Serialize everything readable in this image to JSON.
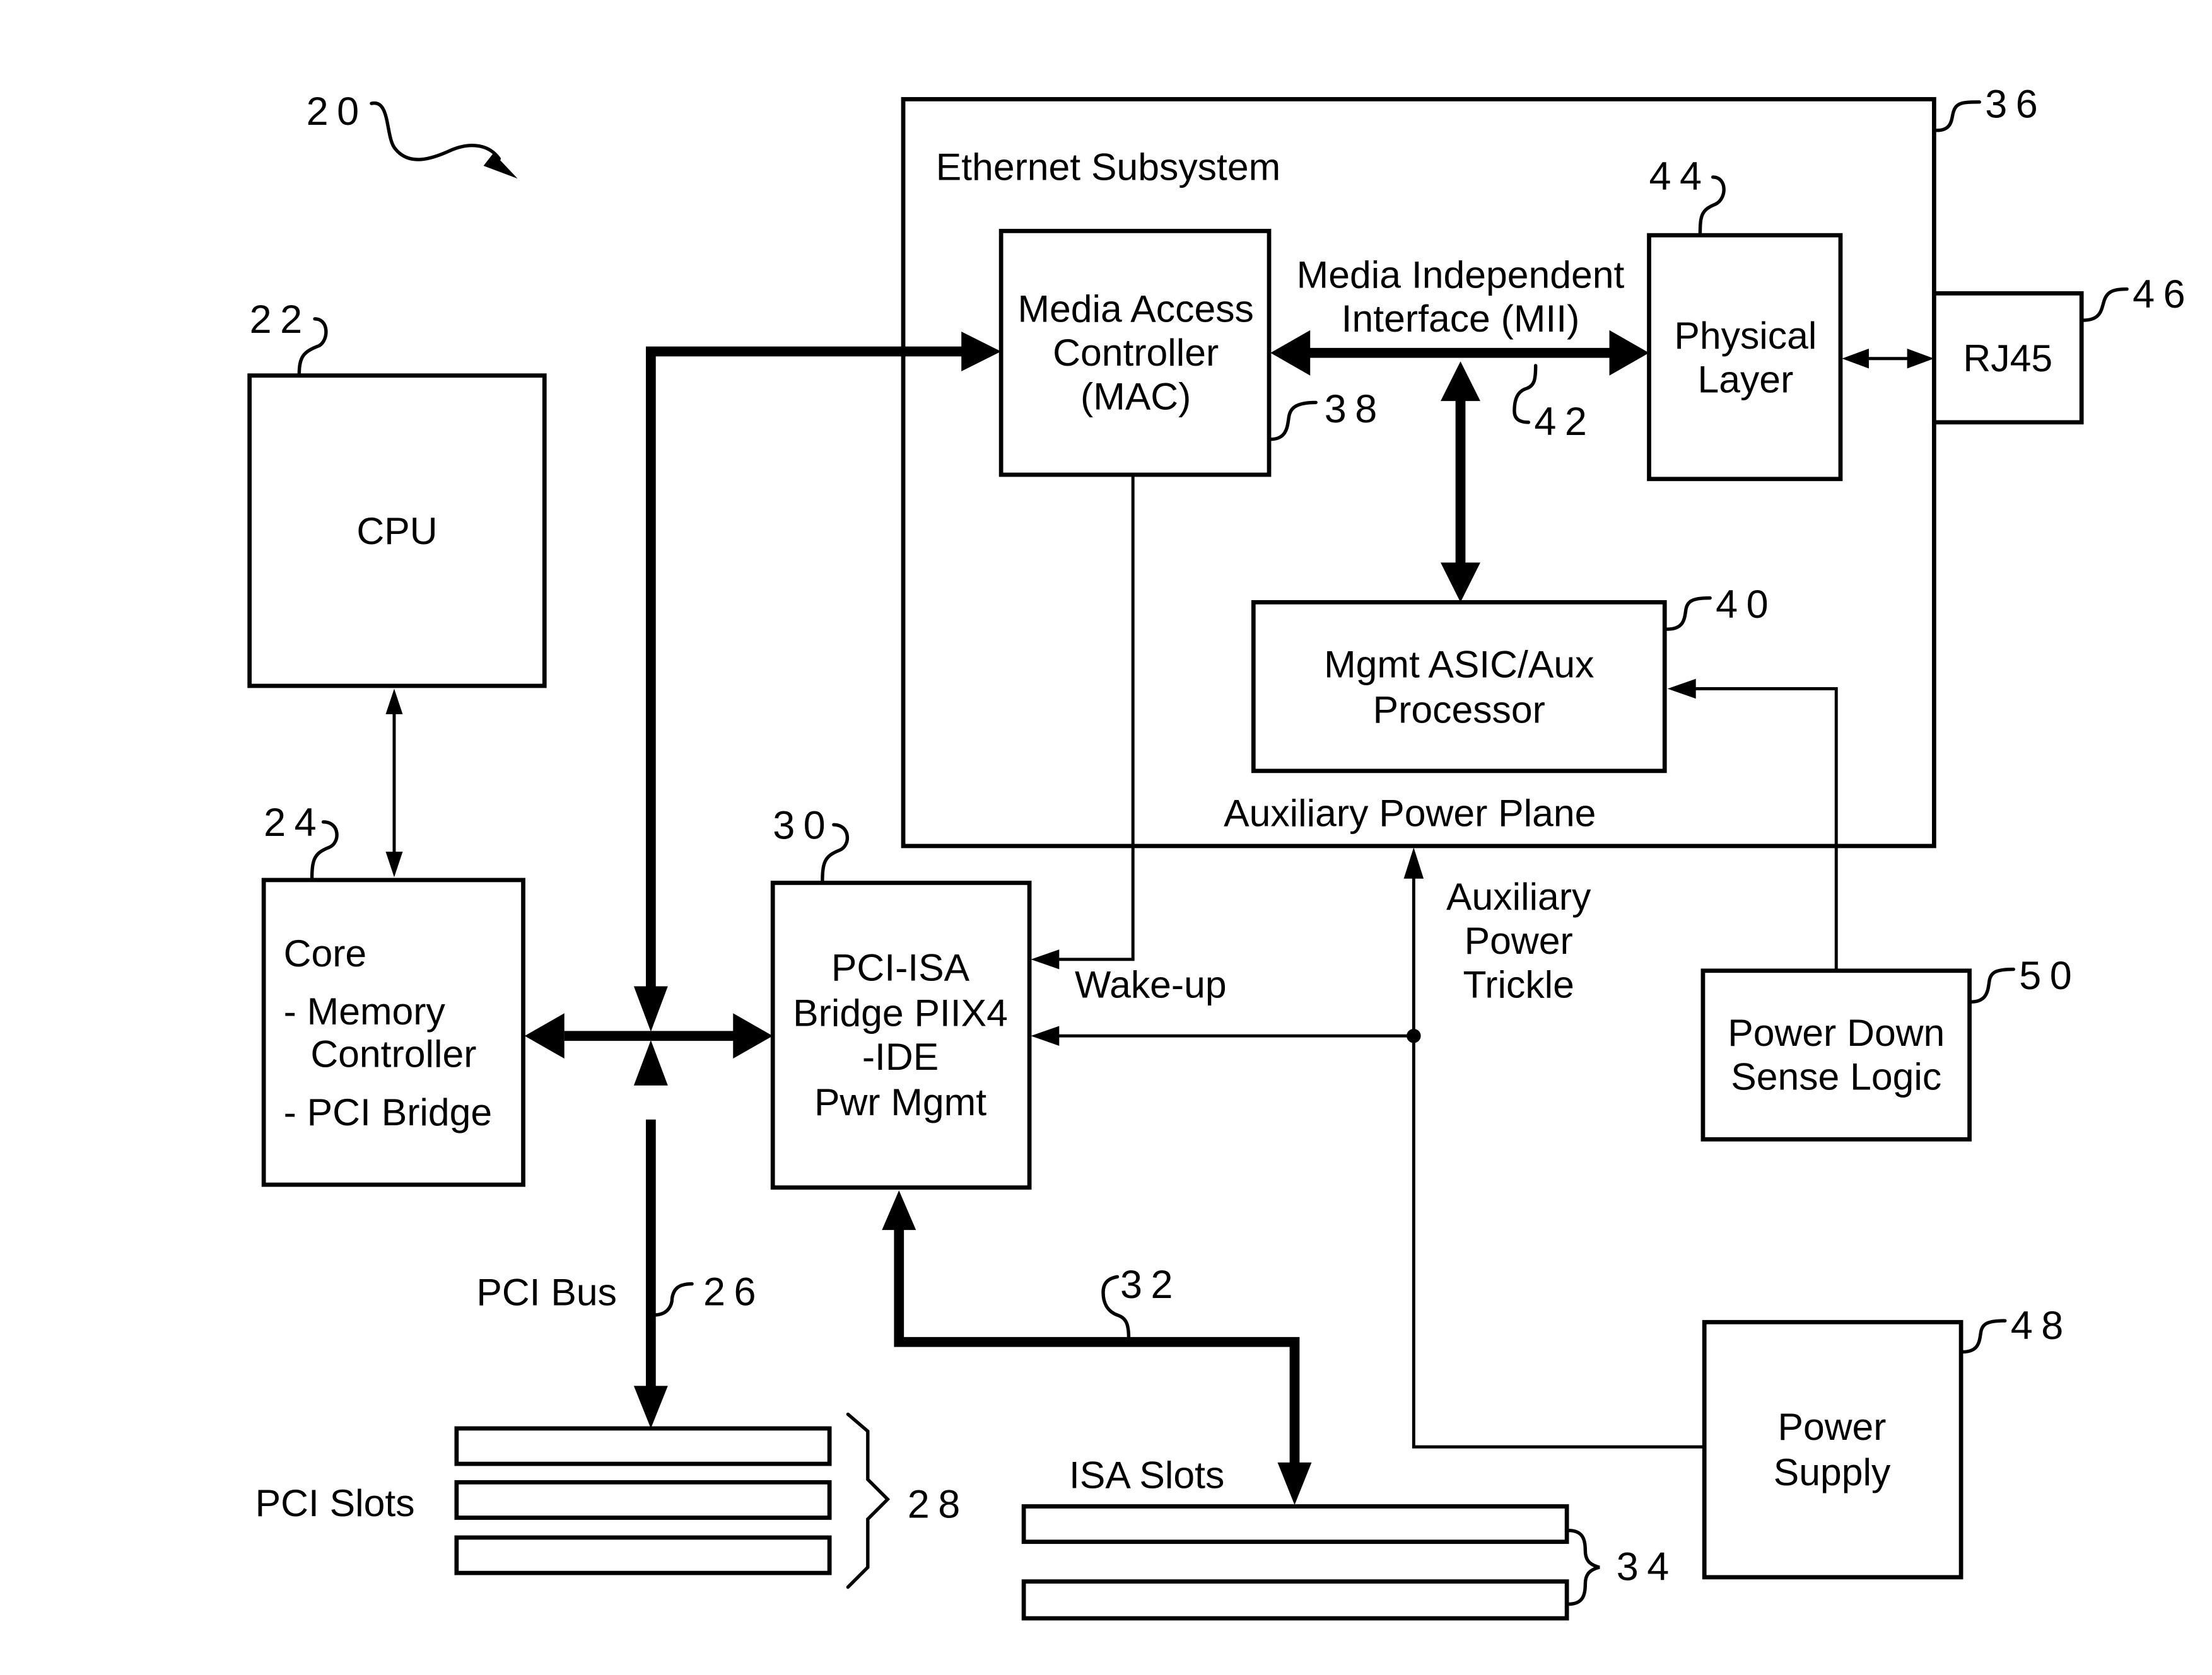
{
  "figure": {
    "ref": "20"
  },
  "blocks": {
    "cpu": {
      "label": [
        "CPU"
      ],
      "ref": "22"
    },
    "core": {
      "label": [
        "Core",
        "- Memory",
        "Controller",
        "- PCI Bridge"
      ],
      "ref": "24"
    },
    "pci_isa_bridge": {
      "label": [
        "PCI-ISA",
        "Bridge PIIX4",
        "-IDE",
        "Pwr Mgmt"
      ],
      "ref": "30"
    },
    "ethernet_subsystem": {
      "label": "Ethernet Subsystem",
      "plane_label": "Auxiliary Power Plane",
      "ref": "36"
    },
    "mac": {
      "label": [
        "Media Access",
        "Controller",
        "(MAC)"
      ],
      "ref": "38"
    },
    "mgmt_asic": {
      "label": [
        "Mgmt ASIC/Aux",
        "Processor"
      ],
      "ref": "40"
    },
    "physical_layer": {
      "label": [
        "Physical",
        "Layer"
      ],
      "ref": "44"
    },
    "rj45": {
      "label": [
        "RJ45"
      ],
      "ref": "46"
    },
    "power_supply": {
      "label": [
        "Power",
        "Supply"
      ],
      "ref": "48"
    },
    "power_down_sense": {
      "label": [
        "Power Down",
        "Sense Logic"
      ],
      "ref": "50"
    },
    "pci_slots": {
      "label": "PCI Slots",
      "ref": "28",
      "count": 3
    },
    "isa_slots": {
      "label": "ISA Slots",
      "ref": "34",
      "count": 2
    }
  },
  "connections": {
    "mii": {
      "label": [
        "Media Independent",
        "Interface (MII)"
      ],
      "ref": "42"
    },
    "pci_bus": {
      "label": "PCI Bus",
      "ref": "26"
    },
    "isa_bus": {
      "ref": "32"
    },
    "wake_up": {
      "label": "Wake-up"
    },
    "aux_power_trickle": {
      "label": [
        "Auxiliary",
        "Power",
        "Trickle"
      ]
    }
  }
}
